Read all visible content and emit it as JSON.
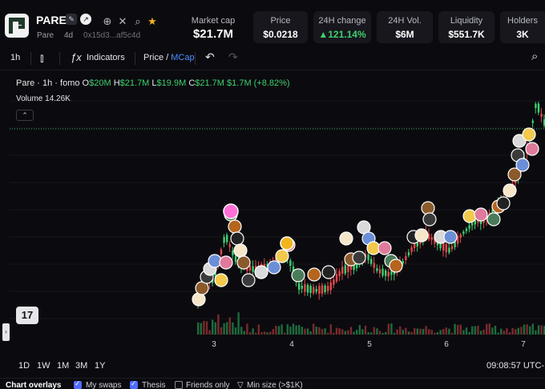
{
  "token": {
    "name": "PARE",
    "symbol": "Pare",
    "age": "4d",
    "address": "0x15d3...af5c4d"
  },
  "stats": {
    "market_cap": {
      "label": "Market cap",
      "value": "$21.7M"
    },
    "price": {
      "label": "Price",
      "value": "$0.0218"
    },
    "change_24h": {
      "label": "24H change",
      "value": "121.14%"
    },
    "volume_24h": {
      "label": "24H Vol.",
      "value": "$6M"
    },
    "liquidity": {
      "label": "Liquidity",
      "value": "$551.7K"
    },
    "holders": {
      "label": "Holders",
      "value": "3K"
    }
  },
  "toolbar": {
    "interval": "1h",
    "indicators": "Indicators",
    "price": "Price",
    "slash": "/",
    "mcap": "MCap"
  },
  "legend": {
    "title": "Pare · 1h · fomo",
    "o_label": "O",
    "o_value": "$20M",
    "h_label": "H",
    "h_value": "$21.7M",
    "l_label": "L",
    "l_value": "$19.9M",
    "c_label": "C",
    "c_value": "$21.7M",
    "change": "$1.7M (+8.82%)",
    "volume_label": "Volume",
    "volume_value": "14.26K"
  },
  "chart_data": {
    "type": "candlestick",
    "x_ticks": [
      "3",
      "4",
      "5",
      "6",
      "7"
    ],
    "series": [
      {
        "name": "Volume",
        "values": [
          14.26
        ]
      }
    ]
  },
  "ranges": [
    "1D",
    "1W",
    "1M",
    "3M",
    "1Y"
  ],
  "clock": "09:08:57 UTC-",
  "overlays": {
    "title": "Chart overlays",
    "my_swaps": "My swaps",
    "thesis": "Thesis",
    "friends_only": "Friends only",
    "min_size": "Min size (>$1K)"
  },
  "colors": {
    "up": "#3ecf6e",
    "down": "#e5484d",
    "accent": "#4f8cff"
  }
}
